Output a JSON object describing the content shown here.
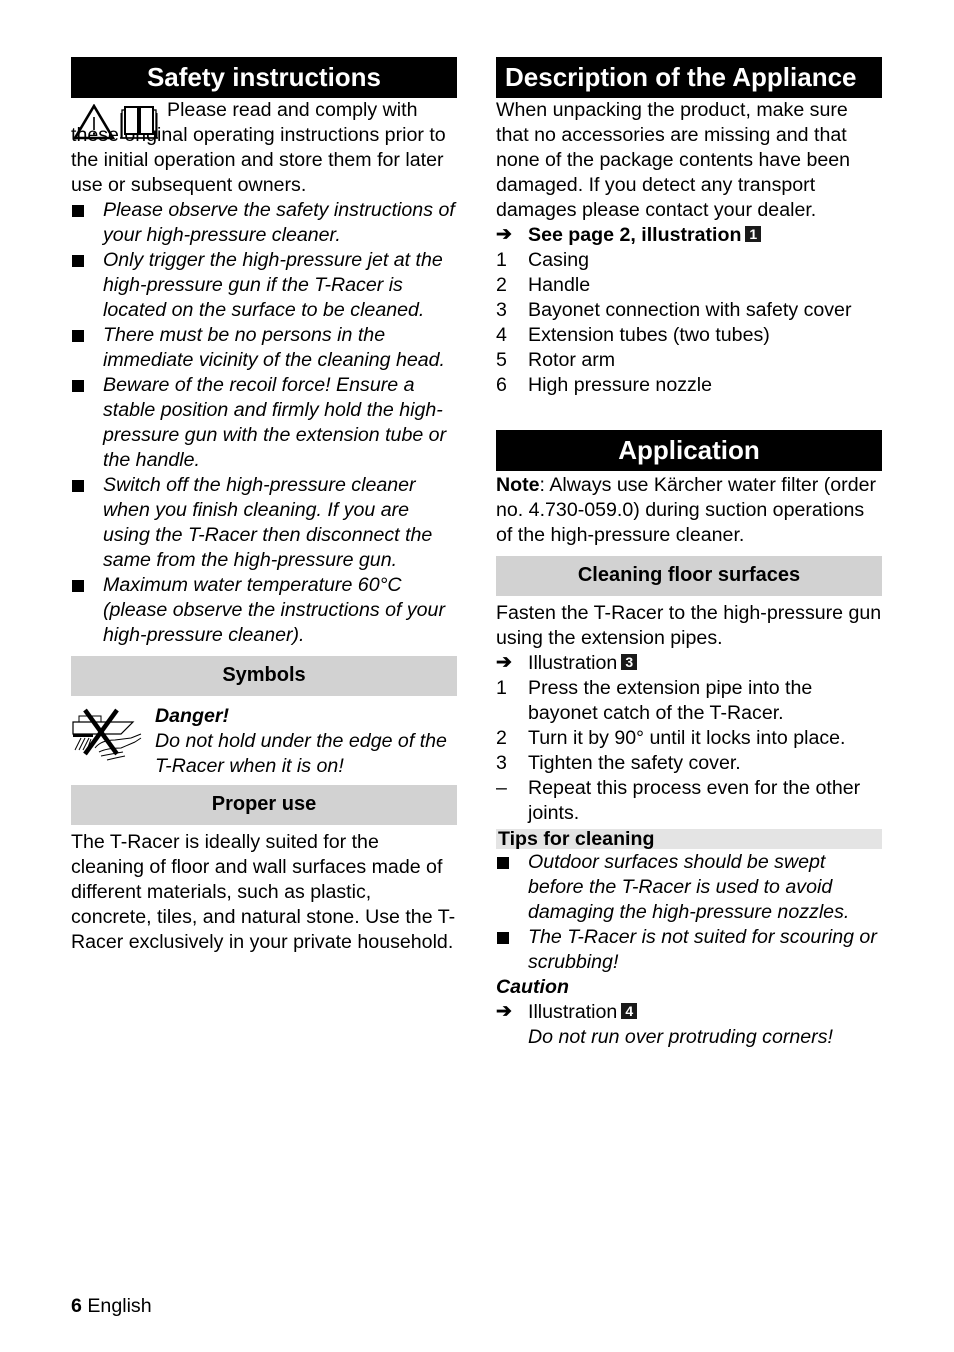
{
  "left": {
    "safety": {
      "title": "Safety instructions",
      "intro": "Please read and comply with these original operating instructions prior to the initial operation and store them for later use or subsequent owners.",
      "bullets": [
        "Please observe the safety instructions of your high-pressure cleaner.",
        "Only trigger the high-pressure jet at the high-pressure gun if the T-Racer is located on the surface to be cleaned.",
        "There must be no persons in the immediate vicinity of the cleaning head.",
        "Beware of the recoil force! Ensure a stable position and firmly hold the high-pressure gun with the extension tube or the handle.",
        "Switch off the high-pressure cleaner when you finish cleaning. If you are using the T-Racer then disconnect the same from the high-pressure gun.",
        "Maximum water temperature 60°C (please observe the instructions of your high-pressure cleaner)."
      ]
    },
    "symbols": {
      "title": "Symbols",
      "danger_label": "Danger!",
      "danger_text": "Do not hold under the edge of the T-Racer when it is on!"
    },
    "proper_use": {
      "title": "Proper use",
      "text": "The T-Racer is ideally suited for the cleaning of floor and wall surfaces made of different materials, such as plastic, concrete, tiles, and natural stone. Use the T-Racer exclusively in your private household."
    }
  },
  "right": {
    "description": {
      "title": "Description of the Appliance",
      "text": "When unpacking the product, make sure that no accessories are missing and that none of the package contents have been damaged. If you detect any transport damages please contact your dealer.",
      "see_page": "See page 2, illustration",
      "see_page_badge": "1",
      "items": [
        {
          "num": "1",
          "label": "Casing"
        },
        {
          "num": "2",
          "label": "Handle"
        },
        {
          "num": "3",
          "label": "Bayonet connection with safety cover"
        },
        {
          "num": "4",
          "label": "Extension tubes (two tubes)"
        },
        {
          "num": "5",
          "label": "Rotor arm"
        },
        {
          "num": "6",
          "label": "High pressure nozzle"
        }
      ]
    },
    "application": {
      "title": "Application",
      "note_label": "Note",
      "note_text": ": Always use Kärcher water filter (order no. 4.730-059.0) during suction operations of the high-pressure cleaner."
    },
    "cleaning_floor": {
      "title": "Cleaning floor surfaces",
      "text": "Fasten the T-Racer to the high-pressure gun using the extension pipes.",
      "illustration_label": "Illustration",
      "illustration_badge": "3",
      "steps": [
        {
          "num": "1",
          "label": "Press the extension pipe into the bayonet catch of the T-Racer."
        },
        {
          "num": "2",
          "label": "Turn it by 90° until it locks into place."
        },
        {
          "num": "3",
          "label": "Tighten the safety cover."
        },
        {
          "num": "–",
          "label": "Repeat this process even for the other joints."
        }
      ]
    },
    "tips": {
      "title": "Tips for cleaning",
      "bullets": [
        "Outdoor surfaces should be swept before the T-Racer is used to avoid damaging the high-pressure nozzles.",
        "The T-Racer is not suited for scouring or scrubbing!"
      ],
      "caution_label": "Caution",
      "illustration_label": "Illustration",
      "illustration_badge": "4",
      "caution_text": "Do not run over protruding corners!"
    }
  },
  "footer": {
    "page_number": "6",
    "language": "English"
  },
  "icons": {
    "arrow": "➔"
  }
}
